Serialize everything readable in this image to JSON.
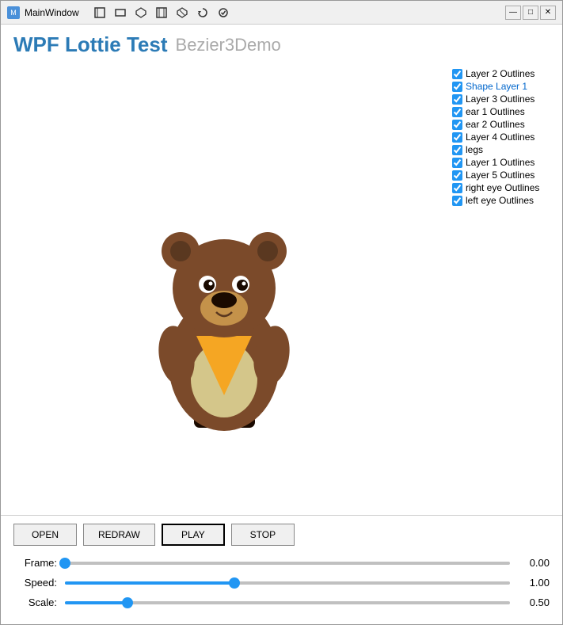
{
  "window": {
    "title": "MainWindow",
    "icon_label": "M"
  },
  "toolbar": {
    "buttons": [
      "⬜",
      "▭",
      "⬡",
      "⬛",
      "⬢",
      "⟳",
      "✓"
    ]
  },
  "header": {
    "title_main": "WPF Lottie Test",
    "title_sub": "Bezier3Demo"
  },
  "layers": [
    {
      "id": "layer2",
      "label": "Layer 2 Outlines",
      "checked": true
    },
    {
      "id": "shapelayer1",
      "label": "Shape Layer 1",
      "checked": true,
      "selected": true
    },
    {
      "id": "layer3",
      "label": "Layer 3 Outlines",
      "checked": true
    },
    {
      "id": "ear1",
      "label": "ear 1 Outlines",
      "checked": true
    },
    {
      "id": "ear2",
      "label": "ear 2 Outlines",
      "checked": true
    },
    {
      "id": "layer4",
      "label": "Layer 4 Outlines",
      "checked": true
    },
    {
      "id": "legs",
      "label": "legs",
      "checked": true
    },
    {
      "id": "layer1",
      "label": "Layer 1 Outlines",
      "checked": true
    },
    {
      "id": "layer5",
      "label": "Layer 5 Outlines",
      "checked": true
    },
    {
      "id": "righteye",
      "label": "right eye Outlines",
      "checked": true
    },
    {
      "id": "lefteye",
      "label": "left eye Outlines",
      "checked": true
    }
  ],
  "buttons": {
    "open": "OPEN",
    "redraw": "REDRAW",
    "play": "PLAY",
    "stop": "STOP"
  },
  "sliders": {
    "frame": {
      "label": "Frame:",
      "value": "0.00",
      "pct": 0
    },
    "speed": {
      "label": "Speed:",
      "value": "1.00",
      "pct": 38
    },
    "scale": {
      "label": "Scale:",
      "value": "0.50",
      "pct": 14
    }
  },
  "wincontrols": {
    "minimize": "—",
    "maximize": "□",
    "close": "✕"
  }
}
